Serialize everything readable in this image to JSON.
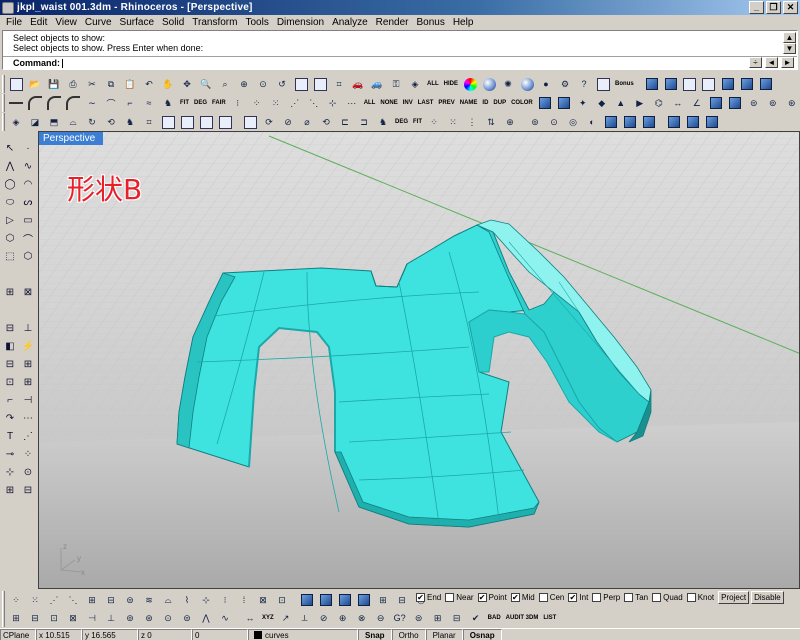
{
  "window": {
    "title": "jkpl_waist 001.3dm - Rhinoceros - [Perspective]",
    "buttons": [
      "_",
      "❐",
      "✕"
    ]
  },
  "menu": [
    "File",
    "Edit",
    "View",
    "Curve",
    "Surface",
    "Solid",
    "Transform",
    "Tools",
    "Dimension",
    "Analyze",
    "Render",
    "Bonus",
    "Help"
  ],
  "command": {
    "history": [
      "Select objects to show:",
      "Select objects to show. Press Enter when done:"
    ],
    "prompt": "Command:",
    "value": ""
  },
  "toolbar_text": {
    "all": "ALL",
    "hide": "HIDE",
    "bonus": "Bonus",
    "row2": [
      "FIT",
      "DEG",
      "FAIR",
      "ALL",
      "NONE",
      "INV",
      "LAST",
      "PREV",
      "NAME",
      "ID",
      "DUP",
      "COLOR"
    ],
    "row3": [
      "DEG",
      "FIT"
    ],
    "btm": [
      "XYZ",
      "BAD",
      "AUDIT 3DM",
      "LIST"
    ]
  },
  "viewport": {
    "tab": "Perspective",
    "label": "形状B",
    "axes": {
      "x": "x",
      "y": "y",
      "z": "z"
    }
  },
  "colors": {
    "surface": "#3ee3e0",
    "surface_dark": "#20a8a8",
    "grid": "#c8c8c8",
    "x_axis": "#5ab05a"
  },
  "osnap": [
    {
      "label": "End",
      "checked": true
    },
    {
      "label": "Near",
      "checked": false
    },
    {
      "label": "Point",
      "checked": true
    },
    {
      "label": "Mid",
      "checked": true
    },
    {
      "label": "Cen",
      "checked": false
    },
    {
      "label": "Int",
      "checked": true
    },
    {
      "label": "Perp",
      "checked": false
    },
    {
      "label": "Tan",
      "checked": false
    },
    {
      "label": "Quad",
      "checked": false
    },
    {
      "label": "Knot",
      "checked": false
    }
  ],
  "osnap_buttons": [
    "Project",
    "Disable"
  ],
  "status": {
    "cplane": "CPlane",
    "x": "x 10.515",
    "y": "y 16.565",
    "z": "z 0",
    "extra": "0",
    "layer": "curves",
    "panes": [
      "Snap",
      "Ortho",
      "Planar",
      "Osnap"
    ]
  }
}
